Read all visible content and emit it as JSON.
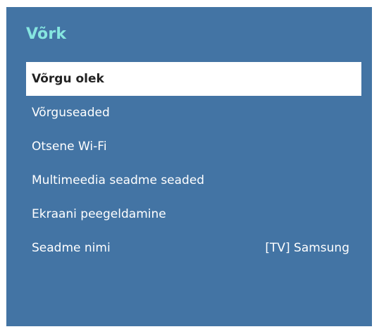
{
  "menu": {
    "title": "Võrk",
    "items": [
      {
        "label": "Võrgu olek",
        "selected": true
      },
      {
        "label": "Võrguseaded"
      },
      {
        "label": "Otsene Wi-Fi"
      },
      {
        "label": "Multimeedia seadme seaded"
      },
      {
        "label": "Ekraani peegeldamine"
      },
      {
        "label": "Seadme nimi",
        "value": "[TV] Samsung"
      }
    ]
  },
  "colors": {
    "panel_background": "#4374a4",
    "title": "#86e6e0",
    "selected_background": "#ffffff",
    "selected_text": "#222222",
    "text": "#ffffff"
  }
}
